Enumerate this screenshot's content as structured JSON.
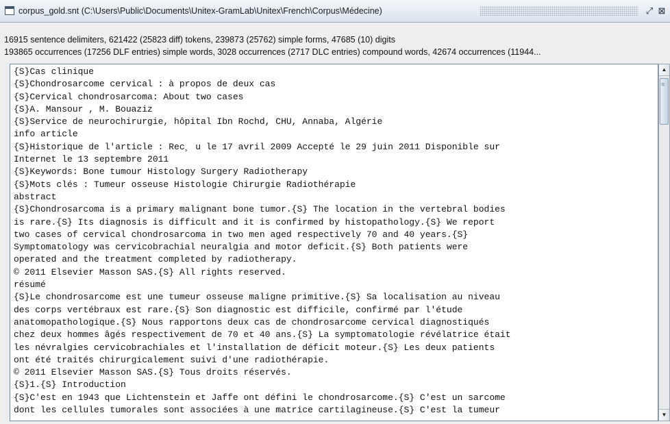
{
  "window": {
    "title": "corpus_gold.snt (C:\\Users\\Public\\Documents\\Unitex-GramLab\\Unitex\\French\\Corpus\\Médecine)"
  },
  "stats": {
    "line1": "16915 sentence delimiters, 621422 (25823 diff) tokens, 239873 (25762) simple forms, 47685 (10) digits",
    "line2": "193865 occurrences (17256 DLF entries) simple words, 3028 occurrences (2717 DLC entries) compound words, 42674 occurrences (11944..."
  },
  "text_lines": [
    "{S}Cas clinique",
    "{S}Chondrosarcome cervical : à propos de deux cas",
    "{S}Cervical chondrosarcoma: About two cases",
    "{S}A. Mansour , M. Bouaziz",
    "{S}Service de neurochirurgie, hôpital Ibn Rochd, CHU, Annaba, Algérie",
    "info article",
    "{S}Historique de l'article : Rec¸ u le 17 avril 2009 Accepté le 29 juin 2011 Disponible sur",
    "Internet le 13 septembre 2011",
    "{S}Keywords: Bone tumour Histology Surgery Radiotherapy",
    "{S}Mots clés : Tumeur osseuse Histologie Chirurgie Radiothérapie",
    "abstract",
    "{S}Chondrosarcoma is a primary malignant bone tumor.{S} The location in the vertebral bodies",
    "is rare.{S} Its diagnosis is difficult and it is confirmed by histopathology.{S} We report",
    "two cases of cervical chondrosarcoma in two men aged respectively 70 and 40 years.{S}",
    "Symptomatology was cervicobrachial neuralgia and motor deficit.{S} Both patients were",
    "operated and the treatment completed by radiotherapy.",
    "© 2011 Elsevier Masson SAS.{S} All rights reserved.",
    "résumé",
    "{S}Le chondrosarcome est une tumeur osseuse maligne primitive.{S} Sa localisation au niveau",
    "des corps vertébraux est rare.{S} Son diagnostic est difficile, confirmé par l'étude",
    "anatomopathologique.{S} Nous rapportons deux cas de chondrosarcome cervical diagnostiqués",
    "chez deux hommes âgés respectivement de 70 et 40 ans.{S} La symptomatologie révélatrice était",
    "les névralgies cervicobrachiales et l'installation de déficit moteur.{S} Les deux patients",
    "ont été traités chirurgicalement suivi d'une radiothérapie.",
    "© 2011 Elsevier Masson SAS.{S} Tous droits réservés.",
    "{S}1.{S} Introduction",
    "{S}C'est en 1943 que Lichtenstein et Jaffe ont défini le chondrosarcome.{S} C'est un sarcome",
    "dont les cellules tumorales sont associées à une matrice cartilagineuse.{S} C'est la tumeur"
  ],
  "icons": {
    "window": "document-window-icon",
    "maximize": "maximize-icon",
    "close": "close-icon",
    "scroll_up": "arrow-up-icon",
    "scroll_down": "arrow-down-icon"
  },
  "glyphs": {
    "maximize": "⤢",
    "close": "⊠",
    "up": "▲",
    "down": "▼",
    "grip": "≡"
  },
  "colors": {
    "title_bar_top": "#f4f7fb",
    "title_bar_bottom": "#d9e2ec",
    "panel_background": "#eeeeee",
    "text_background": "#ffffff"
  }
}
